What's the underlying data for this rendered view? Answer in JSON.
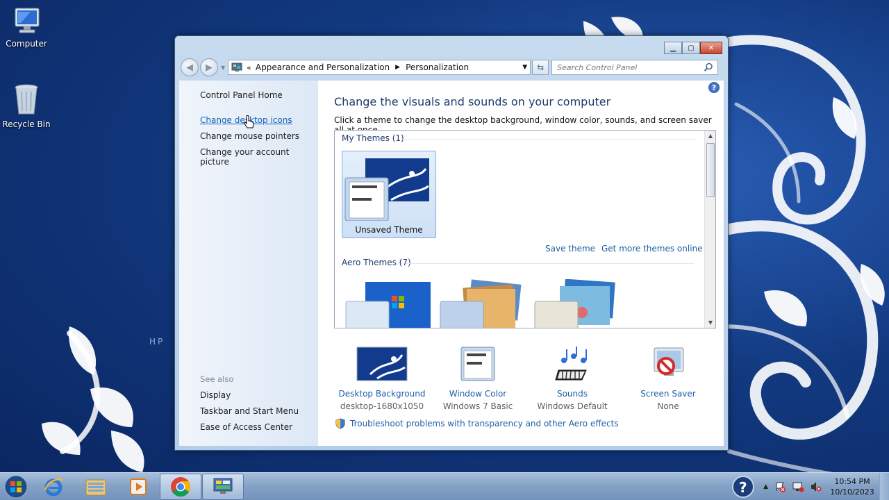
{
  "desktop": {
    "icons": [
      {
        "label": "Computer",
        "icon": "computer-icon"
      },
      {
        "label": "Recycle Bin",
        "icon": "recycle-bin-icon"
      }
    ],
    "watermark": "HP"
  },
  "window": {
    "address": {
      "crumbs": [
        "Appearance and Personalization",
        "Personalization"
      ]
    },
    "search": {
      "placeholder": "Search Control Panel"
    },
    "left_pane": {
      "home": "Control Panel Home",
      "links": [
        "Change desktop icons",
        "Change mouse pointers",
        "Change your account picture"
      ],
      "see_also_title": "See also",
      "see_also": [
        "Display",
        "Taskbar and Start Menu",
        "Ease of Access Center"
      ]
    },
    "main": {
      "title": "Change the visuals and sounds on your computer",
      "subtitle": "Click a theme to change the desktop background, window color, sounds, and screen saver all at once.",
      "my_themes_title": "My Themes (1)",
      "my_theme_label": "Unsaved Theme",
      "save_theme": "Save theme",
      "get_more": "Get more themes online",
      "aero_themes_title": "Aero Themes (7)",
      "settings": [
        {
          "label": "Desktop Background",
          "value": "desktop-1680x1050",
          "icon": "desktop-background-icon"
        },
        {
          "label": "Window Color",
          "value": "Windows 7 Basic",
          "icon": "window-color-icon"
        },
        {
          "label": "Sounds",
          "value": "Windows Default",
          "icon": "sounds-icon"
        },
        {
          "label": "Screen Saver",
          "value": "None",
          "icon": "screen-saver-icon"
        }
      ],
      "troubleshoot": "Troubleshoot problems with transparency and other Aero effects"
    }
  },
  "taskbar": {
    "clock_time": "10:54 PM",
    "clock_date": "10/10/2023"
  }
}
